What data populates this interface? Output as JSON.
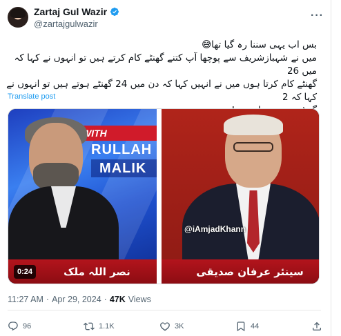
{
  "author": {
    "name": "Zartaj Gul Wazir",
    "handle": "@zartajgulwazir"
  },
  "tweet": {
    "lines": [
      "بس اب یہی سننا رہ گیا تھا😅",
      "میں نے شہبازشریف سے پوچھا آپ کتنے گھنٹے کام کرتے ہیں تو انہوں نے کہا کہ میں 26",
      "گھنٹے کام کرتا ہوں میں نے انہیں کہا کہ دن میں 24 گھنٹے ہوتے ہیں تو انہوں نے کہا کہ 2",
      "گھنٹے میں سوتا ہوں !"
    ],
    "translate_label": "Translate post"
  },
  "media": {
    "left_banner_top": "WITH",
    "left_banner_mid": "RULLAH",
    "left_banner_low": "MALIK",
    "watermark": "@iAmjadKhann",
    "lower_left": "نصر اللہ ملک",
    "lower_right": "سینئر عرفان صدیقی",
    "duration": "0:24"
  },
  "meta": {
    "time": "11:27 AM",
    "dot1": "·",
    "date": "Apr 29, 2024",
    "dot2": "·",
    "views_count": "47K",
    "views_label": "Views"
  },
  "actions": {
    "replies": "96",
    "reposts": "1.1K",
    "likes": "3K",
    "bookmarks": "44"
  },
  "colors": {
    "accent": "#1d9bf0",
    "text_secondary": "#536471"
  }
}
